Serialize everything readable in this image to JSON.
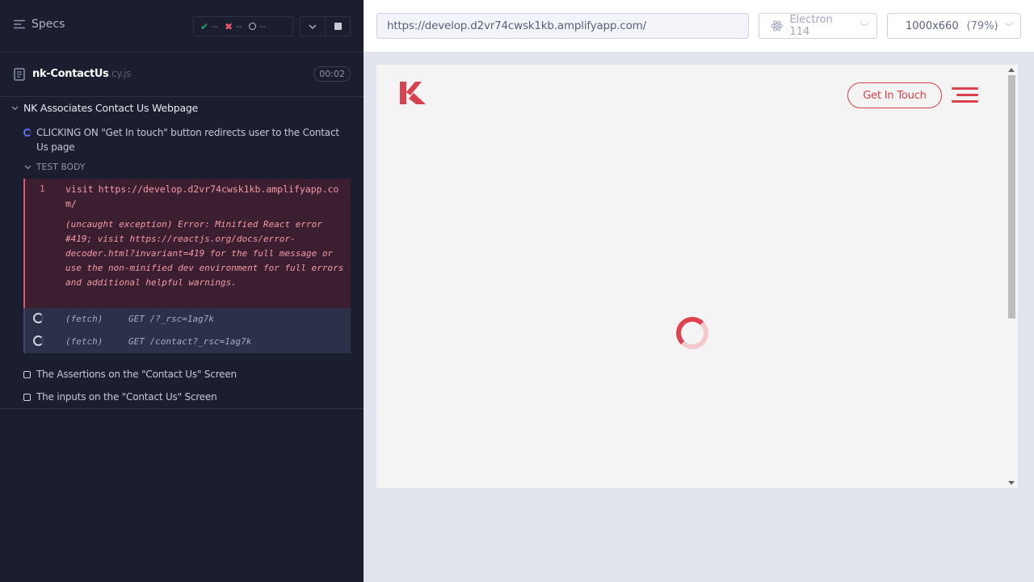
{
  "reporter": {
    "specs_label": "Specs",
    "stats": {
      "passed": "--",
      "failed": "--",
      "pending": "--"
    },
    "spec": {
      "name": "nk-ContactUs",
      "ext": ".cy.js",
      "duration": "00:02"
    },
    "suite_title": "NK Associates Contact Us Webpage",
    "active_test": "CLICKING ON \"Get In touch\" button redirects user to the Contact Us page",
    "test_body_label": "TEST BODY",
    "commands": {
      "visit": {
        "number": "1",
        "name": "visit",
        "url": "https://develop.d2vr74cwsk1kb.amplifyapp.com/"
      },
      "error": "(uncaught exception)  Error: Minified React error #419; visit https://reactjs.org/docs/error-decoder.html?invariant=419 for the full message or use the non-minified dev environment for full errors and additional helpful warnings.",
      "fetch1": {
        "name": "(fetch)",
        "value": "GET /?_rsc=1ag7k"
      },
      "fetch2": {
        "name": "(fetch)",
        "value": "GET /contact?_rsc=1ag7k"
      }
    },
    "pending_tests": [
      "The Assertions on the \"Contact Us\" Screen",
      "The inputs on the \"Contact Us\" Screen"
    ]
  },
  "aut": {
    "url": "https://develop.d2vr74cwsk1kb.amplifyapp.com/",
    "browser": "Electron 114",
    "viewport": "1000x660",
    "scale": "(79%)",
    "page": {
      "cta_label": "Get In Touch"
    },
    "colors": {
      "brand": "#d8414e",
      "loader_light": "#f3c9cd"
    }
  }
}
